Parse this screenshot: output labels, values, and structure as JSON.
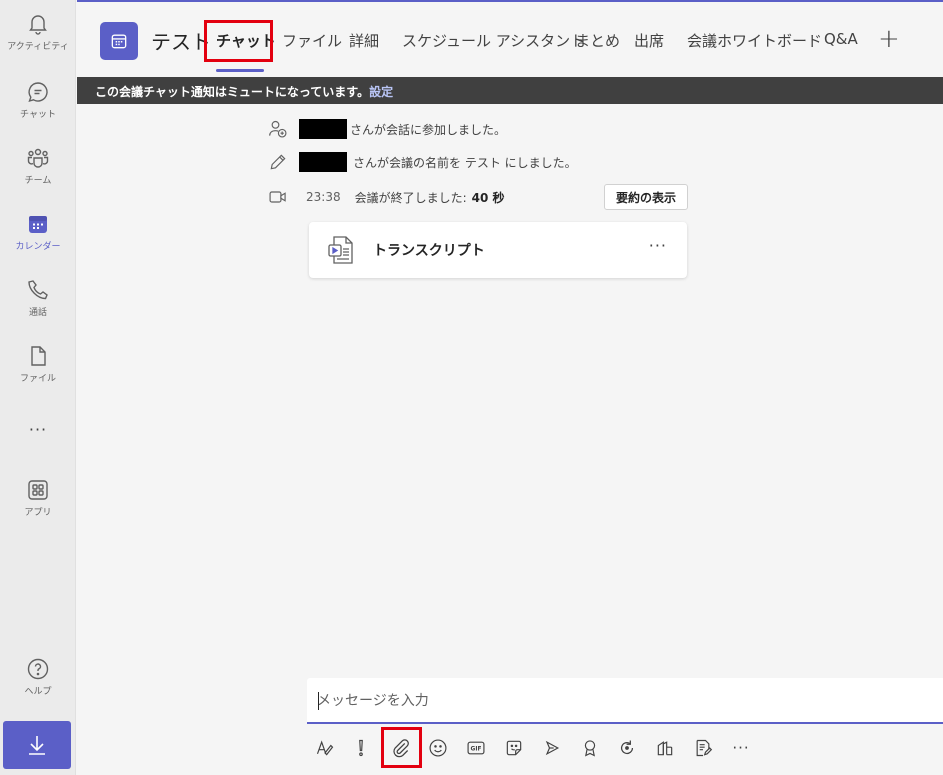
{
  "rail": {
    "items": [
      {
        "label": "アクティビティ",
        "icon": "bell-icon"
      },
      {
        "label": "チャット",
        "icon": "chat-icon"
      },
      {
        "label": "チーム",
        "icon": "teams-icon"
      },
      {
        "label": "カレンダー",
        "icon": "calendar-icon"
      },
      {
        "label": "通話",
        "icon": "phone-icon"
      },
      {
        "label": "ファイル",
        "icon": "file-icon"
      },
      {
        "label": "アプリ",
        "icon": "apps-icon"
      },
      {
        "label": "ヘルプ",
        "icon": "help-icon"
      }
    ],
    "more": "···",
    "active": "カレンダー"
  },
  "header": {
    "title": "テスト",
    "tabs": [
      {
        "label": "チャット",
        "active": true
      },
      {
        "label": "ファイル"
      },
      {
        "label": "詳細"
      },
      {
        "label": "スケジュール アシスタント"
      },
      {
        "label": "まとめ"
      },
      {
        "label": "出席"
      },
      {
        "label": "会議ホワイトボード"
      },
      {
        "label": "Q&A"
      }
    ],
    "add_tab": "+"
  },
  "banner": {
    "text": "この会議チャット通知はミュートになっています。",
    "link": "設定"
  },
  "events": {
    "joined": "さんが会話に参加しました。",
    "renamed": "さんが会議の名前を テスト にしました。",
    "ended_time": "23:38",
    "ended_text": "会議が終了しました:",
    "ended_duration": "40 秒",
    "summary_button": "要約の表示"
  },
  "transcript": {
    "title": "トランスクリプト",
    "more": "···"
  },
  "compose": {
    "placeholder": "メッセージを入力"
  },
  "toolbar": {
    "more": "···",
    "icons": [
      "format-icon",
      "important-icon",
      "attach-icon",
      "emoji-icon",
      "gif-icon",
      "sticker-icon",
      "send-forward-icon",
      "praise-icon",
      "loop-icon",
      "approvals-icon",
      "updates-icon"
    ]
  },
  "colors": {
    "accent": "#5b5fc7",
    "highlight": "#e3000f",
    "banner_bg": "#404040"
  }
}
